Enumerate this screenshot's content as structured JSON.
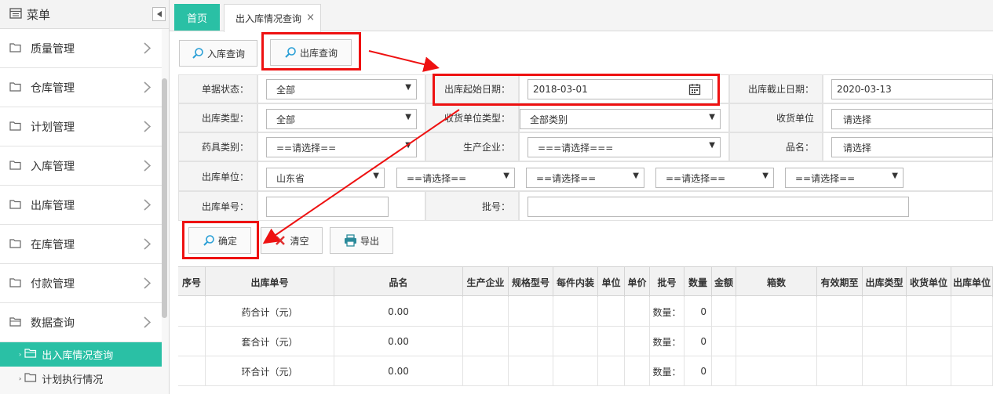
{
  "sidebar": {
    "title": "菜单",
    "items": [
      {
        "label": "质量管理"
      },
      {
        "label": "仓库管理"
      },
      {
        "label": "计划管理"
      },
      {
        "label": "入库管理"
      },
      {
        "label": "出库管理"
      },
      {
        "label": "在库管理"
      },
      {
        "label": "付款管理"
      },
      {
        "label": "数据查询"
      }
    ],
    "subitems": [
      {
        "label": "出入库情况查询",
        "active": true
      },
      {
        "label": "计划执行情况",
        "active": false
      }
    ]
  },
  "tabs": {
    "home": "首页",
    "current": "出入库情况查询",
    "close": "×"
  },
  "toolbar": {
    "in_query": "入库查询",
    "out_query": "出库查询"
  },
  "form": {
    "doc_status_label": "单据状态：",
    "doc_status_value": "全部",
    "start_date_label": "出库起始日期：",
    "start_date_value": "2018-03-01",
    "end_date_label": "出库截止日期：",
    "end_date_value": "2020-03-13",
    "out_type_label": "出库类型：",
    "out_type_value": "全部",
    "recv_type_label": "收货单位类型：",
    "recv_type_value": "全部类别",
    "recv_unit_label": "收货单位",
    "recv_unit_value": "请选择",
    "drug_cat_label": "药具类别：",
    "drug_cat_value": "==请选择==",
    "manufacturer_label": "生产企业：",
    "manufacturer_value": "===请选择===",
    "name_label": "品名：",
    "name_value": "请选择",
    "out_unit_label": "出库单位：",
    "out_unit_province": "山东省",
    "out_unit_level2": "==请选择==",
    "out_unit_level3": "==请选择==",
    "out_unit_level4": "==请选择==",
    "out_unit_level5": "==请选择==",
    "doc_no_label": "出库单号：",
    "doc_no_value": "",
    "batch_label": "批号：",
    "batch_value": ""
  },
  "actions": {
    "confirm": "确定",
    "clear": "清空",
    "export": "导出"
  },
  "table": {
    "columns": [
      "序号",
      "出库单号",
      "品名",
      "生产企业",
      "规格型号",
      "每件内装",
      "单位",
      "单价",
      "批号",
      "数量",
      "金额",
      "箱数",
      "有效期至",
      "出库类型",
      "收货单位",
      "出库单位"
    ],
    "rows": [
      {
        "doc": "药合计（元）",
        "name": "0.00",
        "batch": "数量：",
        "qty": "0"
      },
      {
        "doc": "套合计（元）",
        "name": "0.00",
        "batch": "数量：",
        "qty": "0"
      },
      {
        "doc": "环合计（元）",
        "name": "0.00",
        "batch": "数量：",
        "qty": "0"
      }
    ]
  },
  "colors": {
    "accent": "#2ac0a5",
    "highlight": "#ee1111"
  }
}
